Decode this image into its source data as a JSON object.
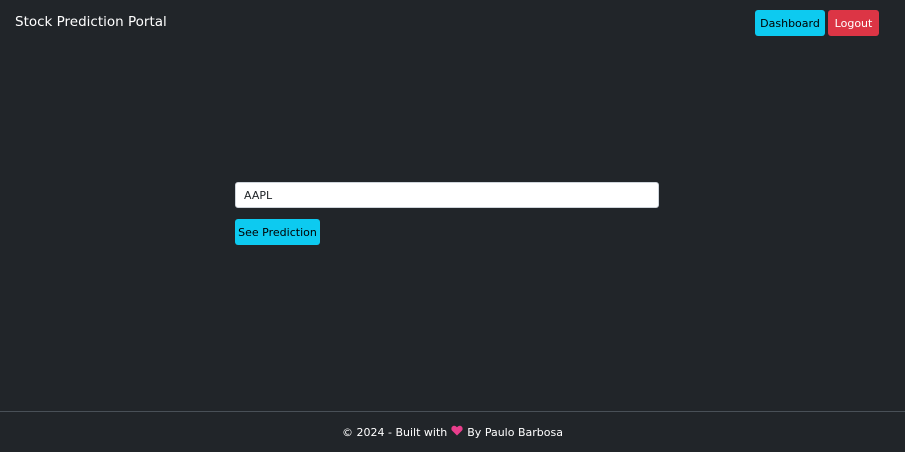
{
  "navbar": {
    "brand": "Stock Prediction Portal",
    "dashboard_label": "Dashboard",
    "logout_label": "Logout"
  },
  "form": {
    "ticker_value": "AAPL",
    "submit_label": "See Prediction"
  },
  "footer": {
    "prefix": "© 2024 - Built with",
    "suffix": "By Paulo Barbosa",
    "icon": "heart-icon"
  },
  "colors": {
    "background": "#212529",
    "info": "#0dcaf0",
    "danger": "#dc3545",
    "heart": "#e83e8c"
  }
}
